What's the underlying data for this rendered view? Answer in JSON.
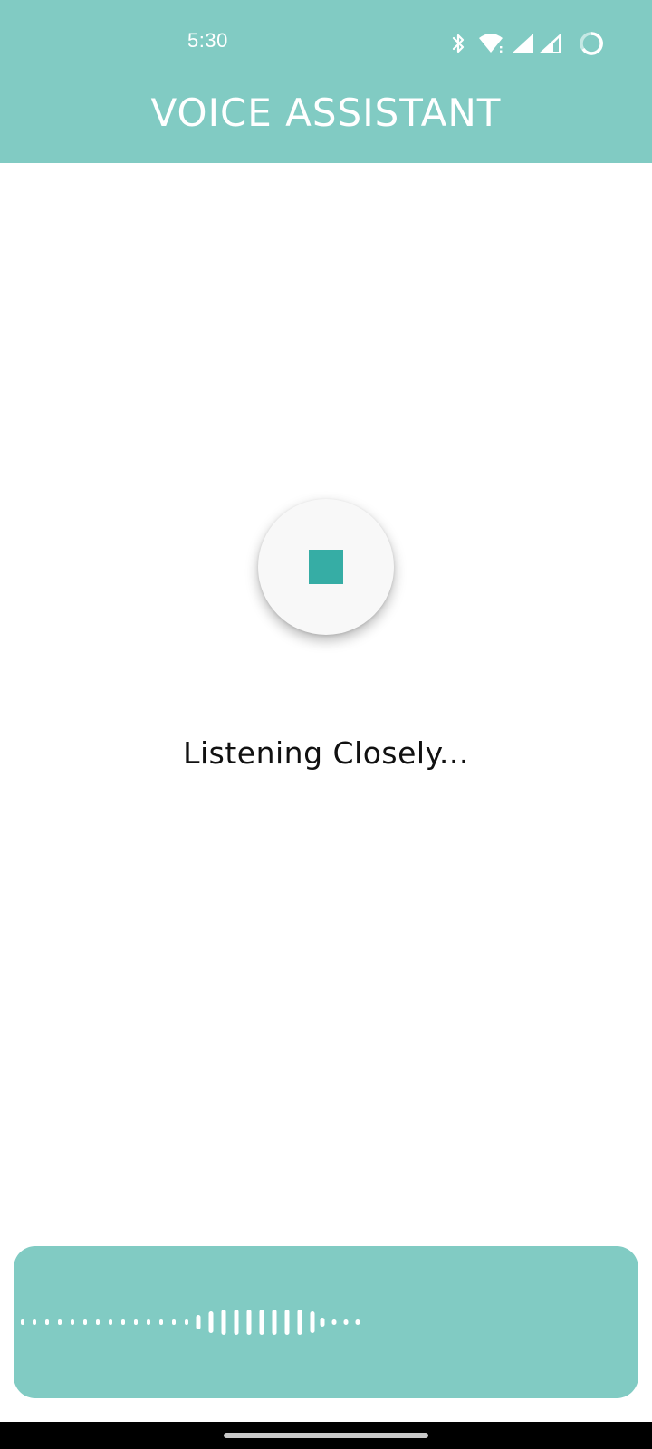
{
  "status_bar": {
    "time": "5:30",
    "icons": [
      "bluetooth-icon",
      "wifi-icon",
      "signal-icon",
      "signal-icon",
      "battery-loading-icon"
    ]
  },
  "header": {
    "title": "VOICE ASSISTANT"
  },
  "main": {
    "stop_button_icon": "stop-icon",
    "status_text": "Listening Closely..."
  },
  "waveform": {
    "icon": "audio-waveform"
  },
  "colors": {
    "accent": "#81cbc3",
    "stop_square": "#36ada5",
    "background": "#ffffff",
    "text": "#111111"
  }
}
